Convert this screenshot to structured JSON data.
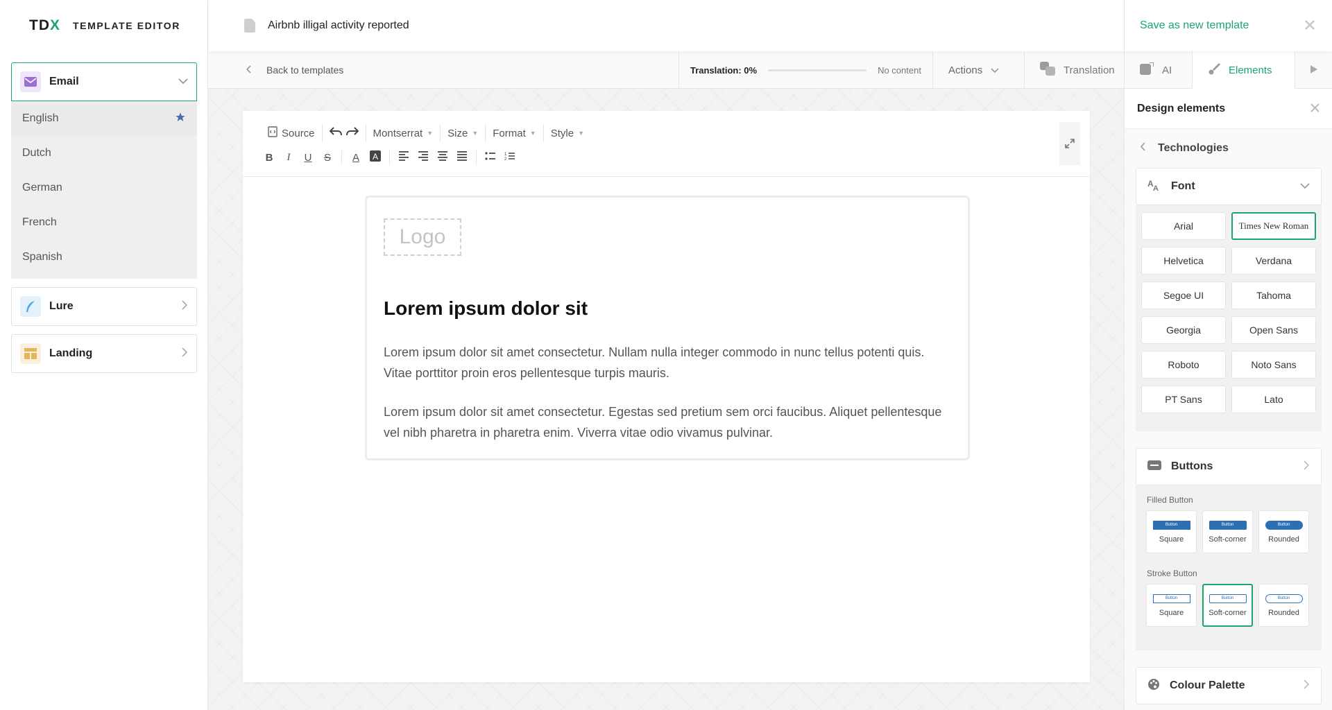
{
  "app": {
    "brand_prefix": "TD",
    "brand_x": "X",
    "subtitle": "TEMPLATE EDITOR"
  },
  "sidebar": {
    "email_label": "Email",
    "languages": [
      {
        "label": "English",
        "default": true
      },
      {
        "label": "Dutch"
      },
      {
        "label": "German"
      },
      {
        "label": "French"
      },
      {
        "label": "Spanish"
      }
    ],
    "lure_label": "Lure",
    "landing_label": "Landing"
  },
  "header": {
    "doc_title": "Airbnb illigal activity reported",
    "save_label": "Save as new template"
  },
  "subbar": {
    "back_label": "Back to templates",
    "translation_label": "Translation: 0%",
    "translation_progress": 0,
    "translation_note": "No content",
    "actions_label": "Actions",
    "translation_tab": "Translation",
    "ai_tab": "AI",
    "elements_tab": "Elements"
  },
  "editor": {
    "toolbar": {
      "source": "Source",
      "font": "Montserrat",
      "size": "Size",
      "format": "Format",
      "style": "Style"
    },
    "email": {
      "logo_placeholder": "Logo",
      "heading": "Lorem ipsum dolor sit",
      "paragraph1": "Lorem ipsum dolor sit amet consectetur. Nullam nulla integer commodo in nunc tellus potenti quis. Vitae porttitor proin eros pellentesque turpis mauris.",
      "paragraph2": "Lorem ipsum dolor sit amet consectetur. Egestas sed pretium sem orci faucibus. Aliquet pellentesque vel nibh pharetra in pharetra enim. Viverra vitae odio vivamus pulvinar."
    }
  },
  "panel": {
    "title": "Design elements",
    "back_label": "Technologies",
    "font_section": "Font",
    "fonts": [
      "Arial",
      "Times New Roman",
      "Helvetica",
      "Verdana",
      "Segoe UI",
      "Tahoma",
      "Georgia",
      "Open Sans",
      "Roboto",
      "Noto Sans",
      "PT Sans",
      "Lato"
    ],
    "selected_font": "Times New Roman",
    "buttons_section": "Buttons",
    "filled_label": "Filled Button",
    "stroke_label": "Stroke Button",
    "mini_text": "Button",
    "button_styles": [
      "Square",
      "Soft-corner",
      "Rounded"
    ],
    "selected_stroke_style": "Soft-corner",
    "palette_section": "Colour Palette"
  },
  "colors": {
    "accent": "#1aa56e",
    "button_blue": "#2c6fb5",
    "email_icon": "#9b6fd6",
    "lure_icon": "#4aa6e0",
    "landing_icon": "#e6b45c"
  }
}
